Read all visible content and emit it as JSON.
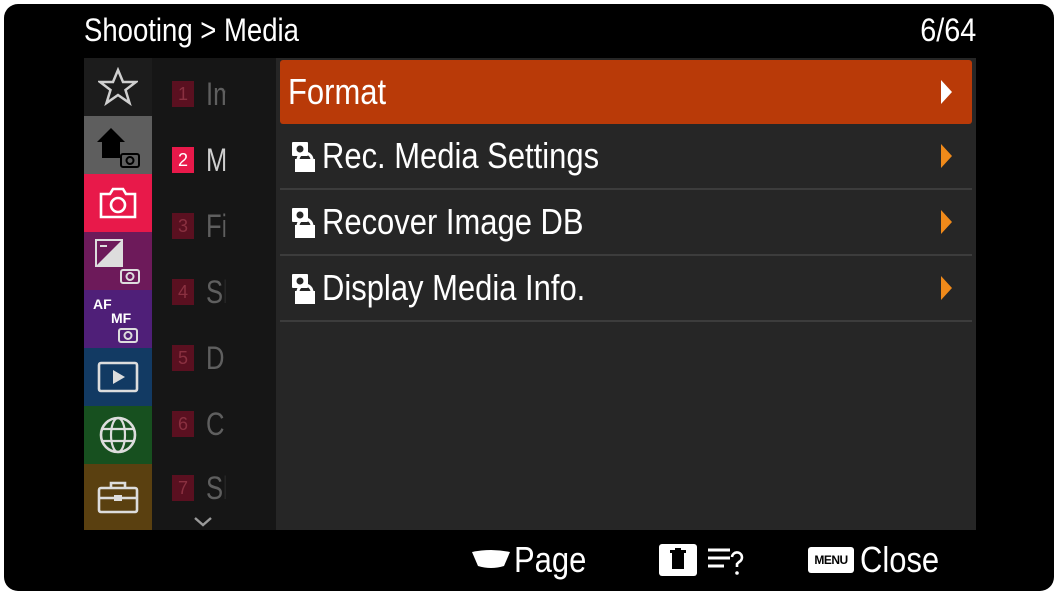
{
  "header": {
    "breadcrumb": "Shooting > Media",
    "page_counter": "6/64"
  },
  "categories": [
    {
      "icon": "star-icon",
      "color": "#1c1c1c"
    },
    {
      "icon": "home-camera-icon",
      "color": "#5e5e5e"
    },
    {
      "icon": "camera-icon",
      "color": "#e8194a"
    },
    {
      "icon": "exposure-camera-icon",
      "color": "#6d1a5a"
    },
    {
      "icon": "af-mf-camera-icon",
      "color": "#4f1f78"
    },
    {
      "icon": "playback-icon",
      "color": "#123a63"
    },
    {
      "icon": "network-globe-icon",
      "color": "#17501f"
    },
    {
      "icon": "toolbox-icon",
      "color": "#5a4010"
    }
  ],
  "submenu": [
    {
      "num": "1",
      "label": "Im"
    },
    {
      "num": "2",
      "label": "M"
    },
    {
      "num": "3",
      "label": "Fi"
    },
    {
      "num": "4",
      "label": "Sh"
    },
    {
      "num": "5",
      "label": "Dr"
    },
    {
      "num": "6",
      "label": "Cc"
    },
    {
      "num": "7",
      "label": "Sh"
    }
  ],
  "items": [
    {
      "label": "Format",
      "locked": false
    },
    {
      "label": "Rec. Media Settings",
      "locked": true
    },
    {
      "label": "Recover Image DB",
      "locked": true
    },
    {
      "label": "Display Media Info.",
      "locked": true
    }
  ],
  "footer": {
    "page_label": "Page",
    "menu_badge": "MENU",
    "close_label": "Close"
  },
  "colors": {
    "accent": "#b93a08",
    "arrow": "#f08a1a",
    "active_tab": "#e8194a"
  }
}
